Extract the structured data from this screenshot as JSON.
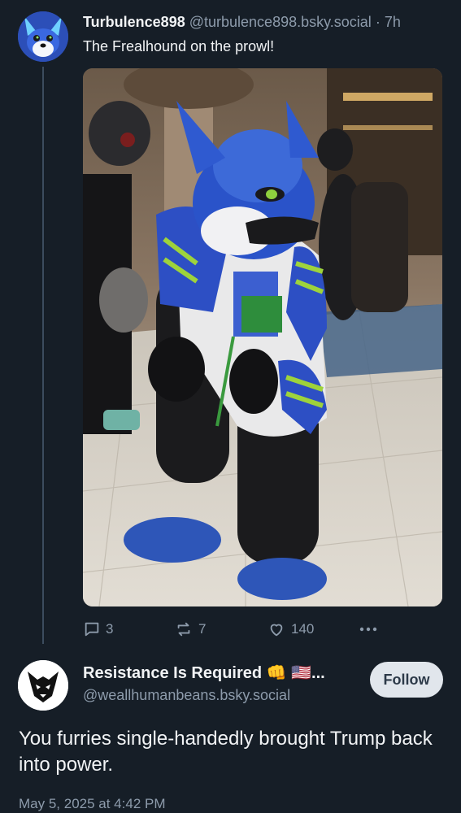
{
  "parent_post": {
    "display_name": "Turbulence898",
    "handle": "@turbulence898.bsky.social",
    "separator": "·",
    "time": "7h",
    "text": "The Frealhound on the prowl!",
    "image_subject": "blue, white and green wolf fursuit in a mall atrium",
    "counts": {
      "replies": "3",
      "reposts": "7",
      "likes": "140"
    }
  },
  "reply_post": {
    "display_name": "Resistance Is Required 👊 🇺🇸...",
    "handle": "@weallhumanbeans.bsky.social",
    "follow_label": "Follow",
    "text": "You furries single-handedly brought Trump back into power.",
    "timestamp": "May 5, 2025 at 4:42 PM"
  },
  "icons": [
    "reply-icon",
    "repost-icon",
    "like-icon",
    "more-icon"
  ],
  "colors": {
    "background": "#161e27",
    "muted_text": "#8d9bab",
    "thread_line": "#3c4c5e",
    "follow_button": "#e1e6ec"
  }
}
